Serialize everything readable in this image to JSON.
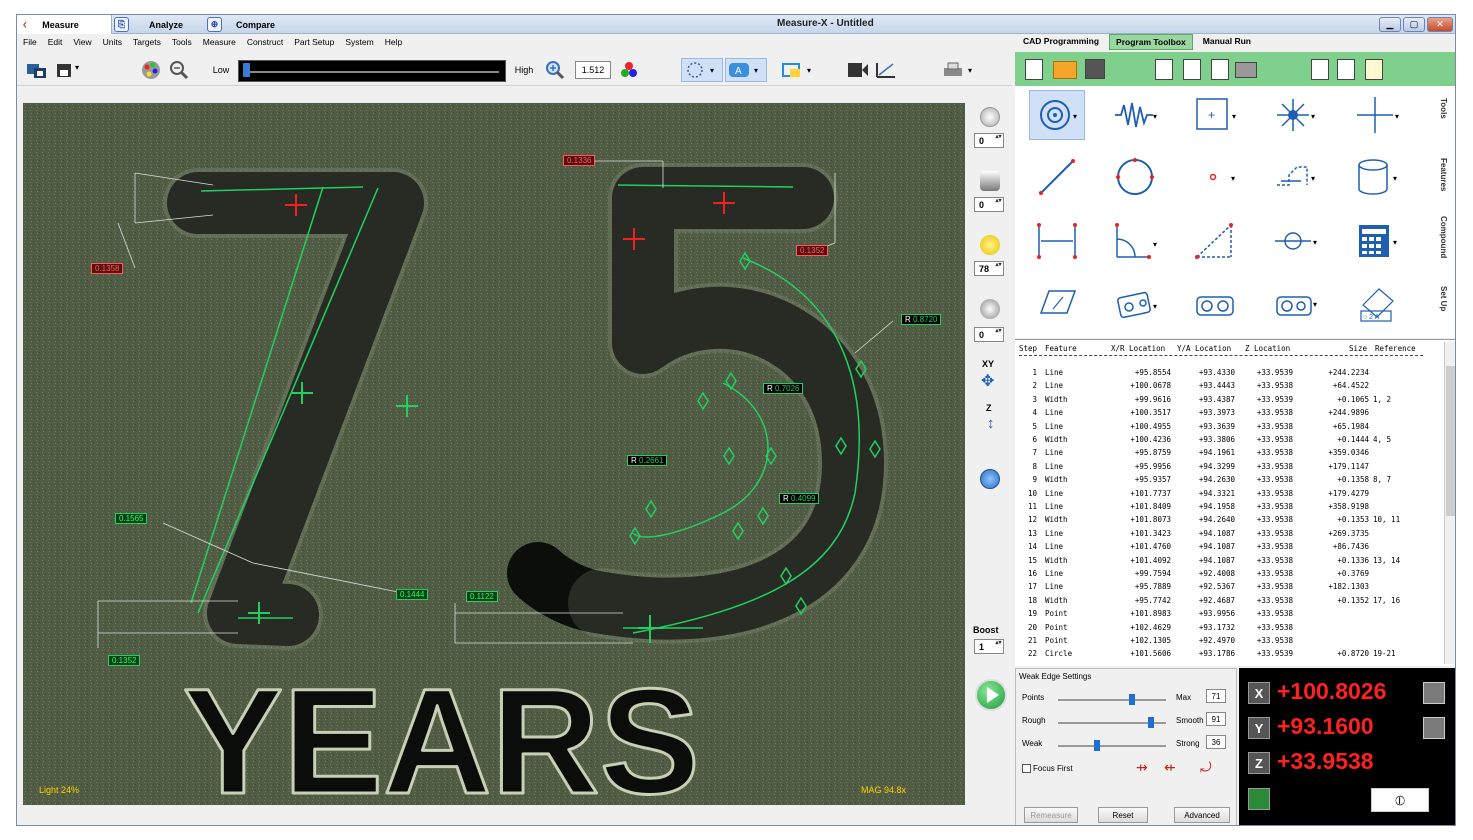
{
  "app": {
    "title": "Measure-X - Untitled",
    "tabs": [
      {
        "label": "Measure"
      },
      {
        "label": "Analyze"
      },
      {
        "label": "Compare"
      }
    ],
    "window_controls": {
      "minimize": "▁",
      "maximize": "▢",
      "close": "✕"
    }
  },
  "menu": [
    "File",
    "Edit",
    "View",
    "Units",
    "Targets",
    "Tools",
    "Measure",
    "Construct",
    "Part Setup",
    "System",
    "Help"
  ],
  "right_tabs": [
    "CAD Programming",
    "Program Toolbox",
    "Manual Run"
  ],
  "toolbar": {
    "low_label": "Low",
    "high_label": "High",
    "zoom_value": "1.512"
  },
  "camera": {
    "light": "Light 24%",
    "mag": "MAG 94.8x",
    "labels": [
      {
        "text": "0.1336",
        "color": "red"
      },
      {
        "text": "0.1358",
        "color": "red"
      },
      {
        "text": "0.1352",
        "color": "red"
      },
      {
        "text": "0.8720",
        "color": "green"
      },
      {
        "text": "0.7026",
        "color": "green"
      },
      {
        "text": "0.2661",
        "color": "green"
      },
      {
        "text": "0.4099",
        "color": "green"
      },
      {
        "text": "0.1565",
        "color": "green"
      },
      {
        "text": "0.1444",
        "color": "green"
      },
      {
        "text": "0.1122",
        "color": "green"
      },
      {
        "text": "0.1352",
        "color": "green"
      }
    ],
    "r_prefix": "R"
  },
  "vertical_controls": {
    "spin_values": [
      "0",
      "0",
      "78",
      "0",
      "1"
    ],
    "xy_label": "XY",
    "z_label": "Z",
    "boost_label": "Boost"
  },
  "side_labels": [
    "Tools",
    "Features",
    "Compound",
    "Set Up"
  ],
  "steps": {
    "headers": {
      "step": "Step",
      "feature": "Feature",
      "x": "X/R Location",
      "y": "Y/A Location",
      "z": "Z Location",
      "size": "Size",
      "ref": "Reference"
    },
    "rows": [
      {
        "n": "1",
        "f": "Line",
        "x": "+95.8554",
        "y": "+93.4330",
        "z": "+33.9539",
        "s": "+244.2234",
        "r": ""
      },
      {
        "n": "2",
        "f": "Line",
        "x": "+100.0678",
        "y": "+93.4443",
        "z": "+33.9538",
        "s": "+64.4522",
        "r": ""
      },
      {
        "n": "3",
        "f": "Width",
        "x": "+99.9616",
        "y": "+93.4387",
        "z": "+33.9539",
        "s": "+0.1065",
        "r": "1, 2"
      },
      {
        "n": "4",
        "f": "Line",
        "x": "+100.3517",
        "y": "+93.3973",
        "z": "+33.9538",
        "s": "+244.9896",
        "r": ""
      },
      {
        "n": "5",
        "f": "Line",
        "x": "+100.4955",
        "y": "+93.3639",
        "z": "+33.9538",
        "s": "+65.1984",
        "r": ""
      },
      {
        "n": "6",
        "f": "Width",
        "x": "+100.4236",
        "y": "+93.3806",
        "z": "+33.9538",
        "s": "+0.1444",
        "r": "4, 5"
      },
      {
        "n": "7",
        "f": "Line",
        "x": "+95.8759",
        "y": "+94.1961",
        "z": "+33.9538",
        "s": "+359.0346",
        "r": ""
      },
      {
        "n": "8",
        "f": "Line",
        "x": "+95.9956",
        "y": "+94.3299",
        "z": "+33.9538",
        "s": "+179.1147",
        "r": ""
      },
      {
        "n": "9",
        "f": "Width",
        "x": "+95.9357",
        "y": "+94.2630",
        "z": "+33.9538",
        "s": "+0.1358",
        "r": "8, 7"
      },
      {
        "n": "10",
        "f": "Line",
        "x": "+101.7737",
        "y": "+94.3321",
        "z": "+33.9538",
        "s": "+179.4279",
        "r": ""
      },
      {
        "n": "11",
        "f": "Line",
        "x": "+101.8409",
        "y": "+94.1958",
        "z": "+33.9538",
        "s": "+358.9198",
        "r": ""
      },
      {
        "n": "12",
        "f": "Width",
        "x": "+101.8073",
        "y": "+94.2640",
        "z": "+33.9538",
        "s": "+0.1353",
        "r": "10, 11"
      },
      {
        "n": "13",
        "f": "Line",
        "x": "+101.3423",
        "y": "+94.1087",
        "z": "+33.9538",
        "s": "+269.3735",
        "r": ""
      },
      {
        "n": "14",
        "f": "Line",
        "x": "+101.4760",
        "y": "+94.1087",
        "z": "+33.9538",
        "s": "+86.7436",
        "r": ""
      },
      {
        "n": "15",
        "f": "Width",
        "x": "+101.4092",
        "y": "+94.1087",
        "z": "+33.9538",
        "s": "+0.1336",
        "r": "13, 14"
      },
      {
        "n": "16",
        "f": "Line",
        "x": "+99.7594",
        "y": "+92.4008",
        "z": "+33.9538",
        "s": "+0.3769",
        "r": ""
      },
      {
        "n": "17",
        "f": "Line",
        "x": "+95.7889",
        "y": "+92.5367",
        "z": "+33.9538",
        "s": "+182.1303",
        "r": ""
      },
      {
        "n": "18",
        "f": "Width",
        "x": "+95.7742",
        "y": "+92.4687",
        "z": "+33.9538",
        "s": "+0.1352",
        "r": "17, 16"
      },
      {
        "n": "19",
        "f": "Point",
        "x": "+101.8983",
        "y": "+93.9956",
        "z": "+33.9538",
        "s": "",
        "r": ""
      },
      {
        "n": "20",
        "f": "Point",
        "x": "+102.4629",
        "y": "+93.1732",
        "z": "+33.9538",
        "s": "",
        "r": ""
      },
      {
        "n": "21",
        "f": "Point",
        "x": "+102.1305",
        "y": "+92.4970",
        "z": "+33.9538",
        "s": "",
        "r": ""
      },
      {
        "n": "22",
        "f": "Circle",
        "x": "+101.5606",
        "y": "+93.1786",
        "z": "+33.9539",
        "s": "+0.8720",
        "r": "19-21"
      }
    ]
  },
  "weak_edge": {
    "title": "Weak Edge Settings",
    "points_label": "Points",
    "rough_label": "Rough",
    "weak_label": "Weak",
    "max_label": "Max",
    "smooth_label": "Smooth",
    "strong_label": "Strong",
    "max_value": "71",
    "smooth_value": "91",
    "strong_value": "36",
    "points_level": 0.7,
    "rough_level": 0.88,
    "weak_level": 0.35,
    "focus_first": "Focus First",
    "remeasure": "Remeasure",
    "reset": "Reset",
    "advanced": "Advanced"
  },
  "dro": {
    "x_axis": "X",
    "y_axis": "Y",
    "z_axis": "Z",
    "x": "+100.8026",
    "y": "+93.1600",
    "z": "+33.9538",
    "value_color": "#ff2020"
  }
}
